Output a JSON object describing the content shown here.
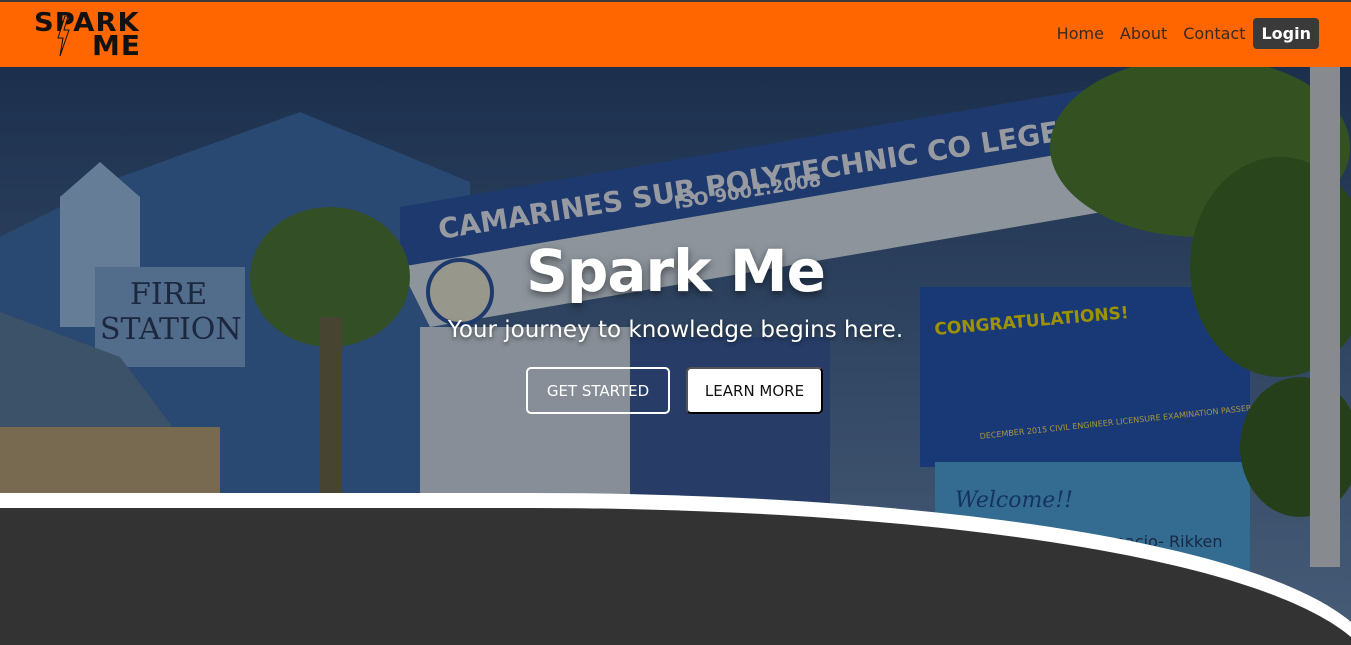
{
  "brand": {
    "logo_line1": "SPARK",
    "logo_line2": "ME",
    "accent": "#ff6600",
    "dark": "#333333"
  },
  "nav": {
    "items": [
      {
        "label": "Home"
      },
      {
        "label": "About"
      },
      {
        "label": "Contact"
      }
    ],
    "login_label": "Login"
  },
  "hero": {
    "title": "Spark Me",
    "subtitle": "Your journey to knowledge begins here.",
    "primary_button": "GET STARTED",
    "secondary_button": "LEARN MORE",
    "photo_signs": {
      "arch_line1": "CAMARINES SUR POLYTECHNIC CO LEGES",
      "arch_line2": "ISO 9001:2008",
      "fire_station_line1": "FIRE",
      "fire_station_line2": "STATION",
      "banner": "CONGRATULATIONS!",
      "banner_footer": "DECEMBER 2015 CIVIL ENGINEER LICENSURE EXAMINATION PASSERS",
      "welcome_sign": "Welcome!!",
      "welcome_name": "Ignacio- Rikken"
    }
  }
}
